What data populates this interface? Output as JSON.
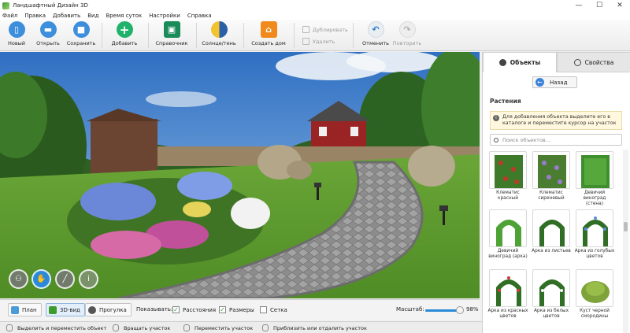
{
  "window": {
    "title": "Ландшафтный Дизайн 3D",
    "minimize": "—",
    "maximize": "☐",
    "close": "✕"
  },
  "menu": [
    "Файл",
    "Правка",
    "Добавить",
    "Вид",
    "Время суток",
    "Настройки",
    "Справка"
  ],
  "toolbar": {
    "new": "Новый",
    "open": "Открыть",
    "save": "Сохранить",
    "add": "Добавить",
    "catalog": "Справочник",
    "sun_shade": "Солнце/тень",
    "create_house": "Создать дом",
    "duplicate": "Дублировать",
    "delete": "Удалить",
    "undo": "Отменить",
    "redo": "Повторить"
  },
  "panel": {
    "tabs": [
      "Объекты",
      "Свойства"
    ],
    "back": "Назад",
    "section": "Растения",
    "hint": "Для добавления объекта выделите его в каталоге и переместите курсор на участок",
    "search_placeholder": "Поиск объектов...",
    "items": [
      {
        "label": "Клематис красный",
        "icon": "clematis-red"
      },
      {
        "label": "Клематис сиреневый",
        "icon": "clematis-lilac"
      },
      {
        "label": "Девичий виноград (стена)",
        "icon": "grape-wall"
      },
      {
        "label": "Девичий виноград (арка)",
        "icon": "grape-arch"
      },
      {
        "label": "Арка из листьев",
        "icon": "leaf-arch"
      },
      {
        "label": "Арка из голубых цветов",
        "icon": "blue-flower-arch"
      },
      {
        "label": "Арка из красных цветов",
        "icon": "red-flower-arch"
      },
      {
        "label": "Арка из белых цветов",
        "icon": "white-flower-arch"
      },
      {
        "label": "Куст черной смородины",
        "icon": "currant-bush"
      }
    ]
  },
  "bottom": {
    "view_modes": [
      "План",
      "3D-вид",
      "Прогулка"
    ],
    "show_label": "Показывать:",
    "checks": [
      {
        "label": "Расстояния",
        "checked": true
      },
      {
        "label": "Размеры",
        "checked": true
      },
      {
        "label": "Сетка",
        "checked": false
      }
    ],
    "zoom_label": "Масштаб:",
    "zoom_value": "98%",
    "zoom_fraction": 0.98
  },
  "status": [
    "Выделить и переместить объект",
    "Вращать участок",
    "Переместить участок",
    "Приблизить или отдалить участок"
  ],
  "colors": {
    "accent": "#2a8ad7",
    "add_green": "#1fb26b",
    "house_orange": "#f08a1c"
  }
}
